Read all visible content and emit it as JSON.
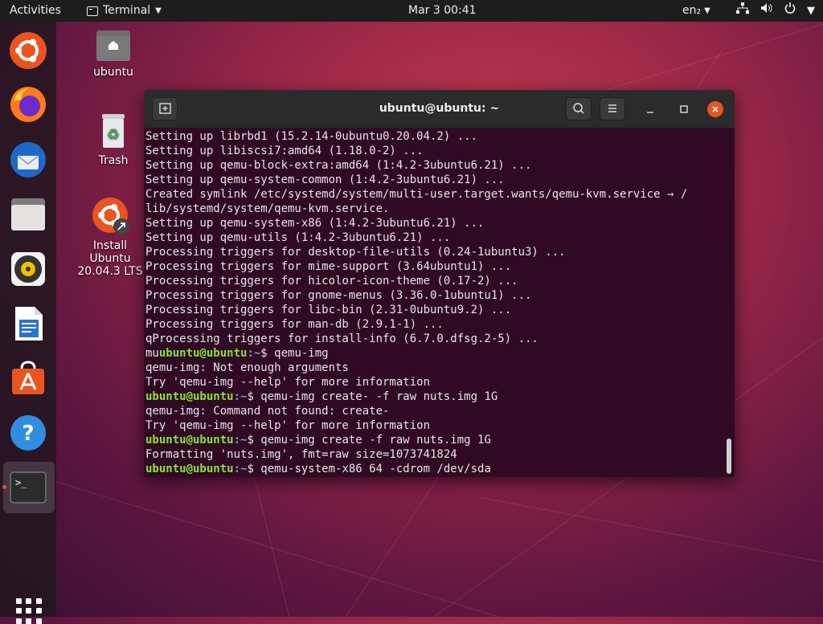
{
  "topbar": {
    "activities": "Activities",
    "app_menu": "Terminal",
    "clock": "Mar 3  00:41",
    "lang": "en₂"
  },
  "desktop": {
    "home_label": "ubuntu",
    "trash_label": "Trash",
    "install_label_1": "Install Ubuntu",
    "install_label_2": "20.04.3 LTS"
  },
  "terminal": {
    "title": "ubuntu@ubuntu: ~",
    "lines": [
      {
        "text": "Setting up librbd1 (15.2.14-0ubuntu0.20.04.2) ..."
      },
      {
        "text": "Setting up libiscsi7:amd64 (1.18.0-2) ..."
      },
      {
        "text": "Setting up qemu-block-extra:amd64 (1:4.2-3ubuntu6.21) ..."
      },
      {
        "text": "Setting up qemu-system-common (1:4.2-3ubuntu6.21) ..."
      },
      {
        "text": "Created symlink /etc/systemd/system/multi-user.target.wants/qemu-kvm.service → /"
      },
      {
        "text": "lib/systemd/system/qemu-kvm.service."
      },
      {
        "text": "Setting up qemu-system-x86 (1:4.2-3ubuntu6.21) ..."
      },
      {
        "text": "Setting up qemu-utils (1:4.2-3ubuntu6.21) ..."
      },
      {
        "text": "Processing triggers for desktop-file-utils (0.24-1ubuntu3) ..."
      },
      {
        "text": "Processing triggers for mime-support (3.64ubuntu1) ..."
      },
      {
        "text": "Processing triggers for hicolor-icon-theme (0.17-2) ..."
      },
      {
        "text": "Processing triggers for gnome-menus (3.36.0-1ubuntu1) ..."
      },
      {
        "text": "Processing triggers for libc-bin (2.31-0ubuntu9.2) ..."
      },
      {
        "text": "Processing triggers for man-db (2.9.1-1) ..."
      },
      {
        "text": "qProcessing triggers for install-info (6.7.0.dfsg.2-5) ..."
      },
      {
        "prefix": "mu",
        "prompt_user": "ubuntu@ubuntu",
        "prompt_path": ":~",
        "cmd": "$ qemu-img"
      },
      {
        "text": "qemu-img: Not enough arguments"
      },
      {
        "text": "Try 'qemu-img --help' for more information"
      },
      {
        "prefix": "",
        "prompt_user": "ubuntu@ubuntu",
        "prompt_path": ":~",
        "cmd": "$ qemu-img create- -f raw nuts.img 1G"
      },
      {
        "text": "qemu-img: Command not found: create-"
      },
      {
        "text": "Try 'qemu-img --help' for more information"
      },
      {
        "prefix": "",
        "prompt_user": "ubuntu@ubuntu",
        "prompt_path": ":~",
        "cmd": "$ qemu-img create -f raw nuts.img 1G"
      },
      {
        "text": "Formatting 'nuts.img', fmt=raw size=1073741824"
      },
      {
        "prefix": "",
        "prompt_user": "ubuntu@ubuntu",
        "prompt_path": ":~",
        "cmd": "$ qemu-system-x86_64 -cdrom /dev/sda"
      }
    ]
  },
  "dock": {
    "items": [
      "ubuntu-icon",
      "firefox-icon",
      "thunderbird-icon",
      "files-icon",
      "rhythmbox-icon",
      "writer-icon",
      "software-icon",
      "help-icon",
      "terminal-icon"
    ]
  },
  "colors": {
    "accent": "#e95420",
    "terminal_bg": "#300a24",
    "prompt_user": "#8ae234",
    "prompt_path": "#729fcf"
  }
}
